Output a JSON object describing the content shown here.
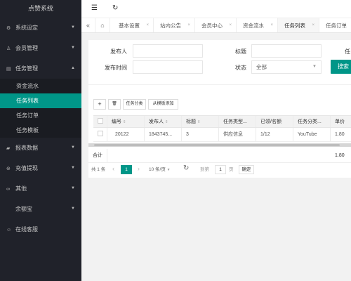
{
  "app": {
    "title": "点赞系统"
  },
  "sidebar": {
    "items": [
      {
        "label": "系统设定",
        "icon": "gear-icon",
        "glyph": "⚙",
        "arrow": "▼"
      },
      {
        "label": "会员管理",
        "icon": "user-icon",
        "glyph": "♙",
        "arrow": "▼"
      },
      {
        "label": "任务管理",
        "icon": "list-icon",
        "glyph": "▤",
        "arrow": "▲"
      },
      {
        "label": "报表数据",
        "icon": "report-icon",
        "glyph": "▰",
        "arrow": "▼"
      },
      {
        "label": "充值提现",
        "icon": "money-icon",
        "glyph": "⊛",
        "arrow": "▼"
      },
      {
        "label": "其他",
        "icon": "link-icon",
        "glyph": "∞",
        "arrow": "▼"
      },
      {
        "label": "余额宝",
        "icon": "wallet-icon",
        "glyph": "",
        "arrow": "▼"
      },
      {
        "label": "在线客服",
        "icon": "service-icon",
        "glyph": "☺",
        "arrow": ""
      }
    ],
    "sub_items": [
      "资金流水",
      "任务列表",
      "任务订单",
      "任务模板"
    ]
  },
  "header": {
    "menu_icon_glyph": "☰",
    "refresh_icon_glyph": "↻"
  },
  "tabs": {
    "prev_glyph": "«",
    "home_glyph": "⌂",
    "close_glyph": "×",
    "items": [
      "基本设置",
      "站内公告",
      "会员中心",
      "资金流水",
      "任务列表",
      "任务订单"
    ]
  },
  "form": {
    "publisher_label": "发布人",
    "title_label": "标题",
    "task_label": "任",
    "publish_time_label": "发布时间",
    "status_label": "状态",
    "status_value": "全部",
    "search_label": "搜索"
  },
  "toolbar": {
    "add_glyph": "+",
    "delete_glyph": "🗑",
    "category_label": "任务分类",
    "template_add_label": "从模板添加"
  },
  "table": {
    "headers": [
      "编号",
      "发布人",
      "标题",
      "任务类型...",
      "已领/名额",
      "任务分类...",
      "单价"
    ],
    "rows": [
      [
        "20122",
        "1843745...",
        "3",
        "供应信息",
        "1/12",
        "YouTube",
        "1.80"
      ]
    ],
    "total_label": "合计",
    "total_price": "1.80"
  },
  "pager": {
    "total_text": "共 1 条",
    "prev_glyph": "‹",
    "next_glyph": "›",
    "current_page": "1",
    "page_size": "10 条/页",
    "goto_label": "到第",
    "goto_value": "1",
    "page_unit": "页",
    "confirm_label": "确定"
  }
}
